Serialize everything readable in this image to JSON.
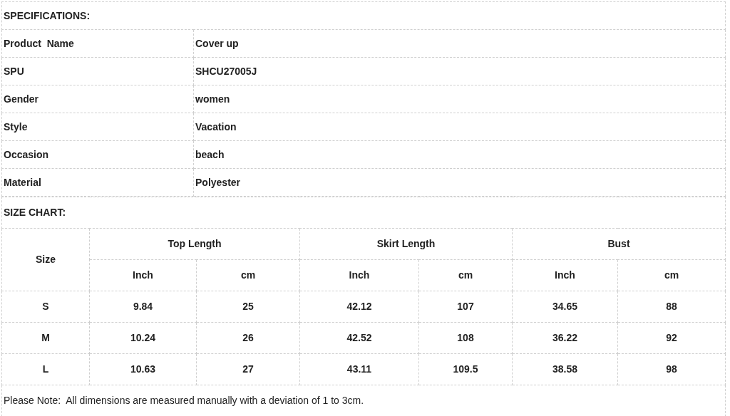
{
  "specifications": {
    "title": "SPECIFICATIONS:",
    "rows": [
      {
        "label": "Product  Name",
        "value": "Cover up"
      },
      {
        "label": "SPU",
        "value": "SHCU27005J"
      },
      {
        "label": "Gender",
        "value": "women"
      },
      {
        "label": "Style",
        "value": "Vacation"
      },
      {
        "label": "Occasion",
        "value": "beach"
      },
      {
        "label": "Material",
        "value": "Polyester"
      }
    ]
  },
  "size_chart": {
    "title": "SIZE CHART:",
    "size_header": "Size",
    "groups": [
      {
        "label": "Top Length",
        "units": [
          "Inch",
          "cm"
        ]
      },
      {
        "label": "Skirt Length",
        "units": [
          "Inch",
          "cm"
        ]
      },
      {
        "label": "Bust",
        "units": [
          "Inch",
          "cm"
        ]
      }
    ],
    "rows": [
      {
        "size": "S",
        "values": [
          "9.84",
          "25",
          "42.12",
          "107",
          "34.65",
          "88"
        ]
      },
      {
        "size": "M",
        "values": [
          "10.24",
          "26",
          "42.52",
          "108",
          "36.22",
          "92"
        ]
      },
      {
        "size": "L",
        "values": [
          "10.63",
          "27",
          "43.11",
          "109.5",
          "38.58",
          "98"
        ]
      }
    ]
  },
  "note": "Please Note:  All dimensions are measured manually with a deviation of 1 to 3cm."
}
